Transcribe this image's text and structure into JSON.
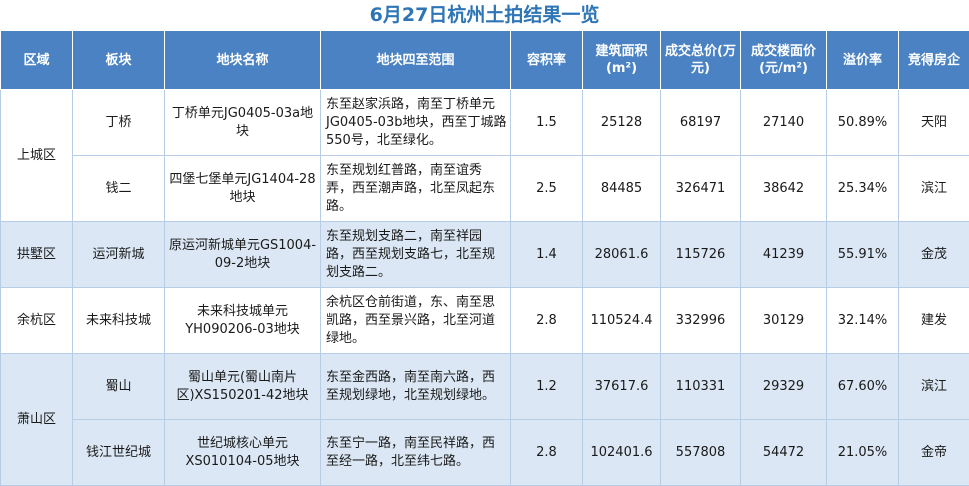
{
  "title": "6月27日杭州土拍结果一览",
  "headers": {
    "district": "区域",
    "block": "板块",
    "plot_name": "地块名称",
    "boundary": "地块四至范围",
    "far": "容积率",
    "area": "建筑面积(m²)",
    "total_price": "成交总价(万元)",
    "floor_price": "成交楼面价(元/m²)",
    "premium": "溢价率",
    "winner": "竞得房企"
  },
  "rows": [
    {
      "district": "上城区",
      "block": "丁桥",
      "plot_name": "丁桥单元JG0405-03a地块",
      "boundary": "东至赵家浜路，南至丁桥单元JG0405-03b地块，西至丁城路550号，北至绿化。",
      "far": "1.5",
      "area": "25128",
      "total_price": "68197",
      "floor_price": "27140",
      "premium": "50.89%",
      "winner": "天阳"
    },
    {
      "district": "",
      "block": "钱二",
      "plot_name": "四堡七堡单元JG1404-28地块",
      "boundary": "东至规划红普路，南至谊秀弄，西至潮声路，北至凤起东路。",
      "far": "2.5",
      "area": "84485",
      "total_price": "326471",
      "floor_price": "38642",
      "premium": "25.34%",
      "winner": "滨江"
    },
    {
      "district": "拱墅区",
      "block": "运河新城",
      "plot_name": "原运河新城单元GS1004-09-2地块",
      "boundary": "东至规划支路二，南至祥园路，西至规划支路七，北至规划支路二。",
      "far": "1.4",
      "area": "28061.6",
      "total_price": "115726",
      "floor_price": "41239",
      "premium": "55.91%",
      "winner": "金茂"
    },
    {
      "district": "余杭区",
      "block": "未来科技城",
      "plot_name": "未来科技城单元YH090206-03地块",
      "boundary": "余杭区仓前街道，东、南至思凯路，西至景兴路，北至河道绿地。",
      "far": "2.8",
      "area": "110524.4",
      "total_price": "332996",
      "floor_price": "30129",
      "premium": "32.14%",
      "winner": "建发"
    },
    {
      "district": "萧山区",
      "block": "蜀山",
      "plot_name": "蜀山单元(蜀山南片区)XS150201-42地块",
      "boundary": "东至金西路，南至南六路，西至规划绿地，北至规划绿地。",
      "far": "1.2",
      "area": "37617.6",
      "total_price": "110331",
      "floor_price": "29329",
      "premium": "67.60%",
      "winner": "滨江"
    },
    {
      "district": "",
      "block": "钱江世纪城",
      "plot_name": "世纪城核心单元XS010104-05地块",
      "boundary": "东至宁一路，南至民祥路，西至经一路，北至纬七路。",
      "far": "2.8",
      "area": "102401.6",
      "total_price": "557808",
      "floor_price": "54472",
      "premium": "21.05%",
      "winner": "金帝"
    }
  ]
}
